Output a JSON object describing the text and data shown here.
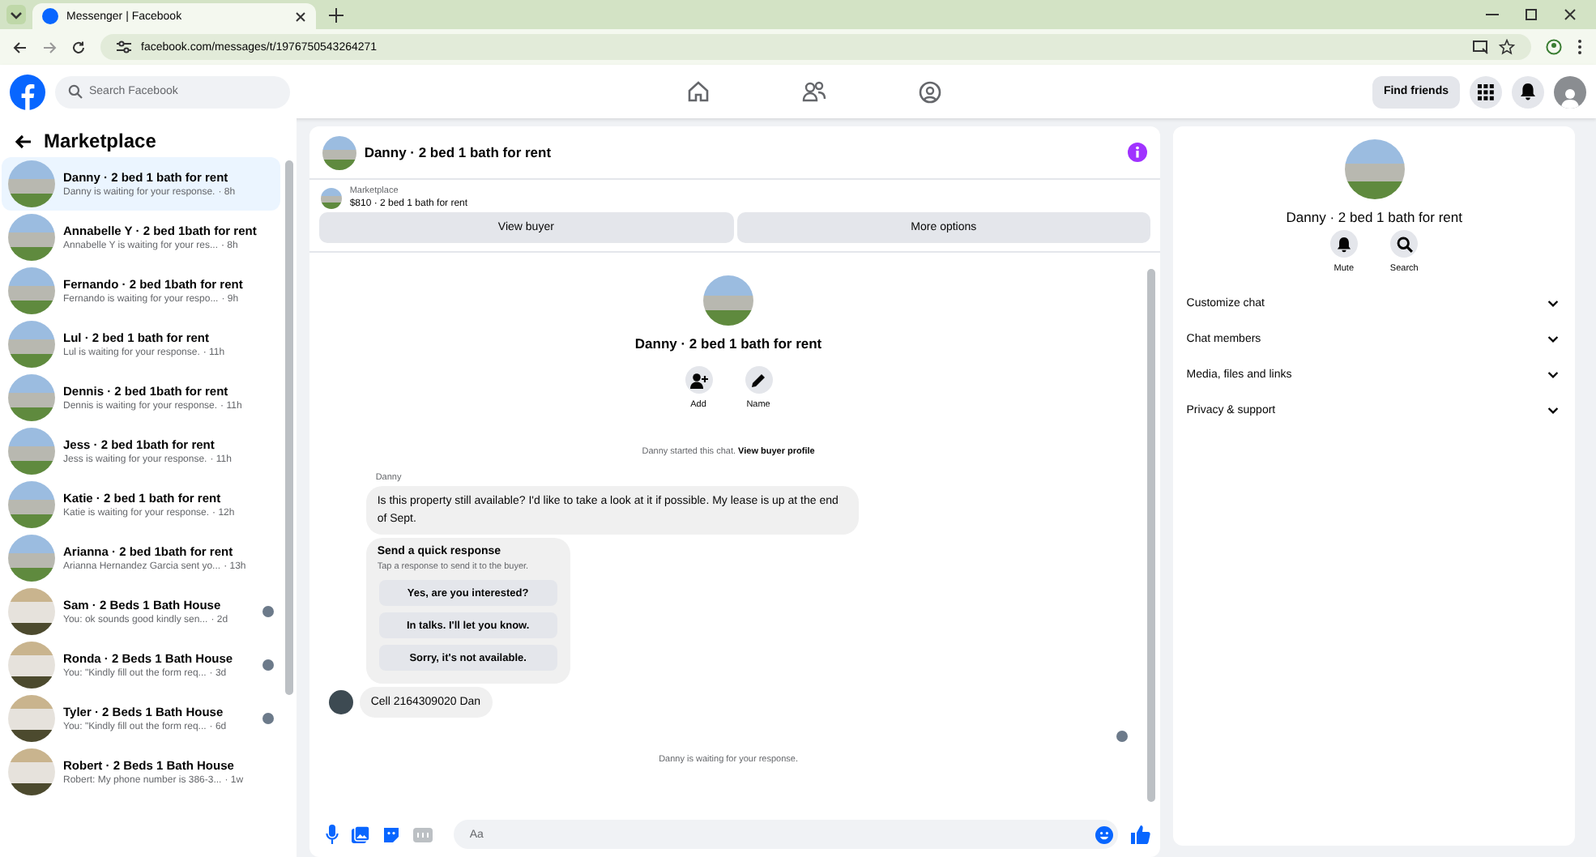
{
  "browser": {
    "tab_title": "Messenger | Facebook",
    "url": "facebook.com/messages/t/1976750543264271"
  },
  "header": {
    "search_placeholder": "Search Facebook",
    "find_friends": "Find friends"
  },
  "sidebar": {
    "title": "Marketplace",
    "items": [
      {
        "title": "Danny · 2 bed 1 bath for rent",
        "preview": "Danny is waiting for your response.",
        "time": "· 8h",
        "selected": true,
        "seen": false
      },
      {
        "title": "Annabelle Y · 2 bed 1bath for rent",
        "preview": "Annabelle Y is waiting for your res...",
        "time": "· 8h",
        "selected": false,
        "seen": false
      },
      {
        "title": "Fernando · 2 bed 1bath for rent",
        "preview": "Fernando is waiting for your respo...",
        "time": "· 9h",
        "selected": false,
        "seen": false
      },
      {
        "title": "Lul · 2 bed 1 bath for rent",
        "preview": "Lul is waiting for your response.",
        "time": "· 11h",
        "selected": false,
        "seen": false
      },
      {
        "title": "Dennis · 2 bed 1bath for rent",
        "preview": "Dennis is waiting for your response.",
        "time": "· 11h",
        "selected": false,
        "seen": false
      },
      {
        "title": "Jess · 2 bed 1bath for rent",
        "preview": "Jess is waiting for your response.",
        "time": "· 11h",
        "selected": false,
        "seen": false
      },
      {
        "title": "Katie · 2 bed 1 bath for rent",
        "preview": "Katie is waiting for your response.",
        "time": "· 12h",
        "selected": false,
        "seen": false
      },
      {
        "title": "Arianna · 2 bed 1bath for rent",
        "preview": "Arianna Hernandez Garcia sent yo...",
        "time": "· 13h",
        "selected": false,
        "seen": false
      },
      {
        "title": "Sam · 2 Beds 1 Bath House",
        "preview": "You: ok sounds good kindly sen...",
        "time": "· 2d",
        "selected": false,
        "seen": true
      },
      {
        "title": "Ronda · 2 Beds 1 Bath House",
        "preview": "You: \"Kindly fill out the form req...",
        "time": "· 3d",
        "selected": false,
        "seen": true
      },
      {
        "title": "Tyler · 2 Beds 1 Bath House",
        "preview": "You: \"Kindly fill out the form req...",
        "time": "· 6d",
        "selected": false,
        "seen": true
      },
      {
        "title": "Robert · 2 Beds 1 Bath House",
        "preview": "Robert: My phone number is 386-3...",
        "time": "· 1w",
        "selected": false,
        "seen": false
      }
    ]
  },
  "chat": {
    "title": "Danny · 2 bed 1 bath for rent",
    "listing_label": "Marketplace",
    "listing": "$810 · 2 bed 1 bath for rent",
    "buttons": [
      "View buyer",
      "More options"
    ],
    "profile_name": "Danny · 2 bed 1 bath for rent",
    "profile_actions": [
      "Add",
      "Name"
    ],
    "started_text": "Danny started this chat.",
    "started_link": "View buyer profile",
    "sender": "Danny",
    "message": "Is this property still available? I'd like to take a look at it if possible. My lease is up at the end of Sept.",
    "quick": {
      "title": "Send a quick response",
      "subtitle": "Tap a response to send it to the buyer.",
      "options": [
        "Yes, are you interested?",
        "In talks. I'll let you know.",
        "Sorry, it's not available."
      ]
    },
    "reply": "Cell 2164309020 Dan",
    "waiting": "Danny is waiting for your response.",
    "composer_placeholder": "Aa"
  },
  "details": {
    "name": "Danny · 2 bed 1 bath for rent",
    "actions": [
      "Mute",
      "Search"
    ],
    "sections": [
      "Customize chat",
      "Chat members",
      "Media, files and links",
      "Privacy & support"
    ]
  }
}
